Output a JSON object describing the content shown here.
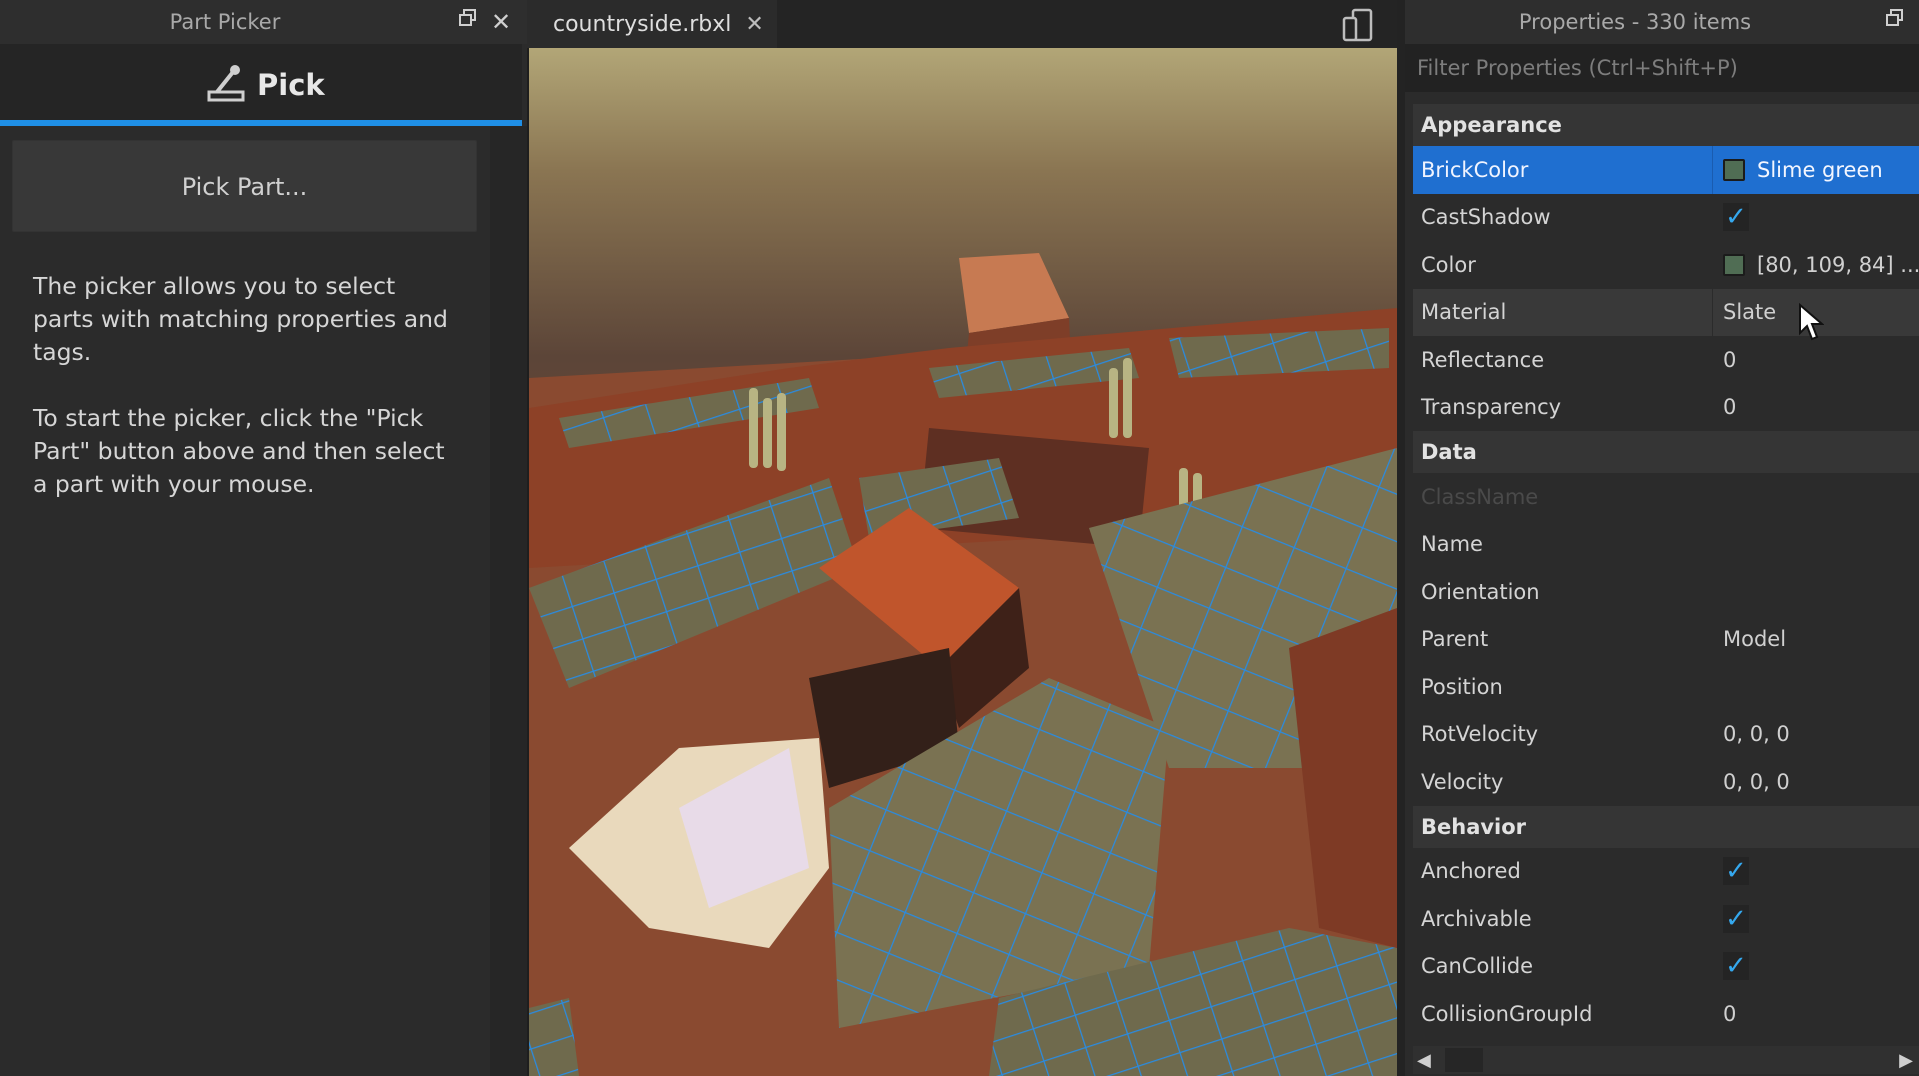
{
  "part_picker": {
    "title": "Part Picker",
    "float_icon": "float-window-icon",
    "close_icon": "close-icon",
    "tab": {
      "label": "Pick",
      "icon": "eyedropper-icon"
    },
    "pick_part_button": "Pick Part...",
    "help_paragraphs": [
      "The picker allows you to select parts with matching properties and tags.",
      "To start the picker, click the \"Pick Part\" button above and then select a part with your mouse."
    ]
  },
  "editor": {
    "tabs": [
      {
        "label": "countryside.rbxl",
        "close": "✕",
        "active": true
      }
    ],
    "device_icon": "device-emulator-icon",
    "viewport": "3D scene: countryside terrain with red-brown cliffs, houses and blue-outlined selected grass/slate parts",
    "selection_outline_color": "#1f8fe6"
  },
  "properties": {
    "title": "Properties - 330 items",
    "float_icon": "float-window-icon",
    "filter_placeholder": "Filter Properties (Ctrl+Shift+P)",
    "categories": [
      {
        "name": "Appearance",
        "rows": [
          {
            "name": "BrickColor",
            "value": "Slime green",
            "swatch": "#506d54",
            "state": "selected"
          },
          {
            "name": "CastShadow",
            "check": true
          },
          {
            "name": "Color",
            "value": "[80, 109, 84] ...",
            "swatch": "#506d54"
          },
          {
            "name": "Material",
            "value": "Slate",
            "state": "hover"
          },
          {
            "name": "Reflectance",
            "value": "0"
          },
          {
            "name": "Transparency",
            "value": "0"
          }
        ]
      },
      {
        "name": "Data",
        "rows": [
          {
            "name": "ClassName",
            "value": "",
            "state": "disabled"
          },
          {
            "name": "Name",
            "value": ""
          },
          {
            "name": "Orientation",
            "value": ""
          },
          {
            "name": "Parent",
            "value": "Model"
          },
          {
            "name": "Position",
            "value": ""
          },
          {
            "name": "RotVelocity",
            "value": "0, 0, 0"
          },
          {
            "name": "Velocity",
            "value": "0, 0, 0"
          }
        ]
      },
      {
        "name": "Behavior",
        "rows": [
          {
            "name": "Anchored",
            "check": true
          },
          {
            "name": "Archivable",
            "check": true
          },
          {
            "name": "CanCollide",
            "check": true
          },
          {
            "name": "CollisionGroupId",
            "value": "0"
          }
        ]
      }
    ],
    "hscroll": {
      "left": "◀",
      "right": "▶"
    }
  },
  "colors": {
    "accent": "#1f8fe6",
    "selected_row": "#1f6fd0",
    "check": "#35a8ee"
  }
}
